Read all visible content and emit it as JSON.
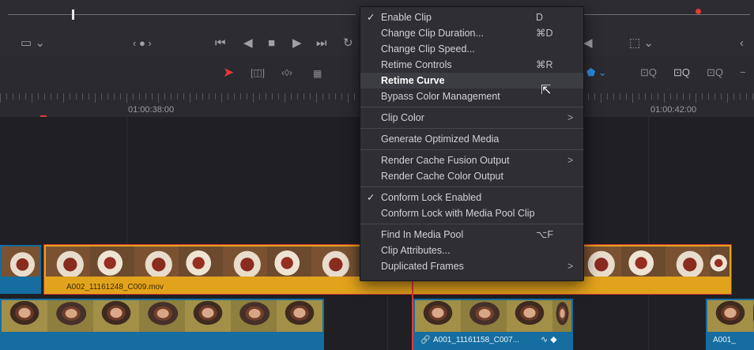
{
  "timeline": {
    "timecode_left": "01:00:38:00",
    "timecode_right": "01:00:42:00"
  },
  "clips": {
    "upper_clip_name": "A002_11161248_C009.mov",
    "lower_clip_name": "A001_11161158_C007...",
    "lower_right_clip_name": "A001_"
  },
  "context_menu": {
    "groups": [
      [
        {
          "label": "Enable Clip",
          "shortcut": "D",
          "checked": true,
          "submenu": false,
          "highlighted": false
        },
        {
          "label": "Change Clip Duration...",
          "shortcut": "⌘D",
          "checked": false,
          "submenu": false,
          "highlighted": false
        },
        {
          "label": "Change Clip Speed...",
          "shortcut": "",
          "checked": false,
          "submenu": false,
          "highlighted": false
        },
        {
          "label": "Retime Controls",
          "shortcut": "⌘R",
          "checked": false,
          "submenu": false,
          "highlighted": false
        },
        {
          "label": "Retime Curve",
          "shortcut": "",
          "checked": false,
          "submenu": false,
          "highlighted": true
        },
        {
          "label": "Bypass Color Management",
          "shortcut": "",
          "checked": false,
          "submenu": false,
          "highlighted": false
        }
      ],
      [
        {
          "label": "Clip Color",
          "shortcut": "",
          "checked": false,
          "submenu": true,
          "highlighted": false
        }
      ],
      [
        {
          "label": "Generate Optimized Media",
          "shortcut": "",
          "checked": false,
          "submenu": false,
          "highlighted": false
        }
      ],
      [
        {
          "label": "Render Cache Fusion Output",
          "shortcut": "",
          "checked": false,
          "submenu": true,
          "highlighted": false
        },
        {
          "label": "Render Cache Color Output",
          "shortcut": "",
          "checked": false,
          "submenu": false,
          "highlighted": false
        }
      ],
      [
        {
          "label": "Conform Lock Enabled",
          "shortcut": "",
          "checked": true,
          "submenu": false,
          "highlighted": false
        },
        {
          "label": "Conform Lock with Media Pool Clip",
          "shortcut": "",
          "checked": false,
          "submenu": false,
          "highlighted": false
        }
      ],
      [
        {
          "label": "Find In Media Pool",
          "shortcut": "⌥F",
          "checked": false,
          "submenu": false,
          "highlighted": false
        },
        {
          "label": "Clip Attributes...",
          "shortcut": "",
          "checked": false,
          "submenu": false,
          "highlighted": false
        },
        {
          "label": "Duplicated Frames",
          "shortcut": "",
          "checked": false,
          "submenu": true,
          "highlighted": false
        }
      ]
    ]
  },
  "icons": {
    "check": "✓",
    "submenu_arrow": ">"
  },
  "colors": {
    "accent_yellow": "#e2a31c",
    "clip_blue": "#156da0",
    "playhead_red": "#e03a3a",
    "selection_red": "#d03030"
  }
}
